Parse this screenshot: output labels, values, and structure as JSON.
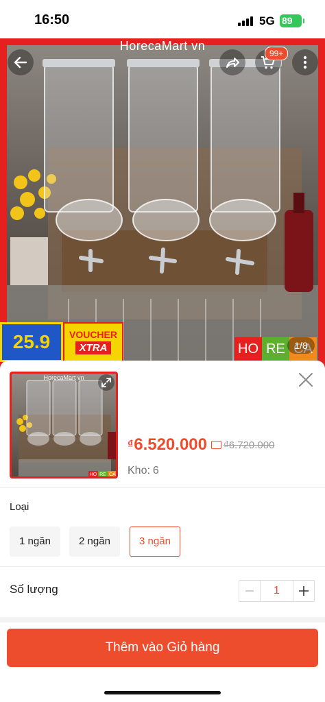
{
  "status_bar": {
    "time": "16:50",
    "network": "5G",
    "battery": "89"
  },
  "hero": {
    "watermark": "HorecaMart vn",
    "cart_badge": "99+",
    "counter": "1/8",
    "promo_1": "25.9",
    "promo_voucher": "VOUCHER",
    "promo_xtra": "XTRA",
    "horeca": [
      "HO",
      "RE",
      "CA"
    ],
    "icons": {
      "back": "back-arrow-icon",
      "share": "share-icon",
      "cart": "cart-icon",
      "more": "more-dots-icon"
    },
    "colors": {
      "frame": "#e5201f",
      "blue": "#1f57c6",
      "yellow": "#f6d400"
    }
  },
  "sheet": {
    "thumbnail_watermark": "HorecaMart vn",
    "thumbnail_horeca": [
      "HO",
      "RE",
      "CA"
    ],
    "price_currency": "₫",
    "price": "6.520.000",
    "original_price": "₫6.720.000",
    "stock_label": "Kho:",
    "stock_value": "6",
    "variant_label": "Loại",
    "variants": [
      {
        "label": "1 ngăn",
        "selected": false
      },
      {
        "label": "2 ngăn",
        "selected": false
      },
      {
        "label": "3 ngăn",
        "selected": true
      }
    ],
    "quantity_label": "Số lượng",
    "quantity": "1",
    "add_to_cart": "Thêm vào Giỏ hàng",
    "accent_color": "#ee4d2d"
  }
}
